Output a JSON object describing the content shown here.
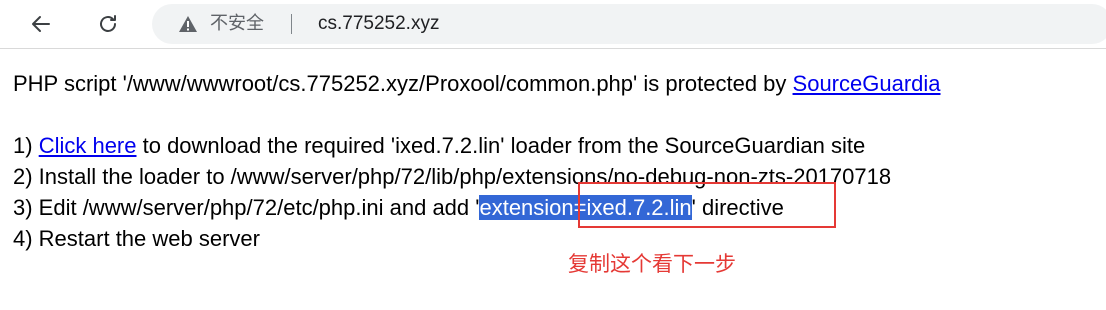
{
  "browser": {
    "security_label": "不安全",
    "url": "cs.775252.xyz"
  },
  "page": {
    "line1_prefix": "PHP script '/www/wwwroot/cs.775252.xyz/Proxool/common.php' is protected by ",
    "line1_link": "SourceGuardia",
    "step1_prefix": "1) ",
    "step1_link": "Click here",
    "step1_suffix": " to download the required 'ixed.7.2.lin' loader from the SourceGuardian site",
    "step2": "2) Install the loader to /www/server/php/72/lib/php/extensions/no-debug-non-zts-20170718",
    "step3_prefix": "3) Edit /www/server/php/72/etc/php.ini and add '",
    "step3_selected": "extension=ixed.7.2.lin",
    "step3_suffix": "' directive",
    "step4": "4) Restart the web server"
  },
  "annotation": {
    "text": "复制这个看下一步",
    "color": "#e53935"
  }
}
